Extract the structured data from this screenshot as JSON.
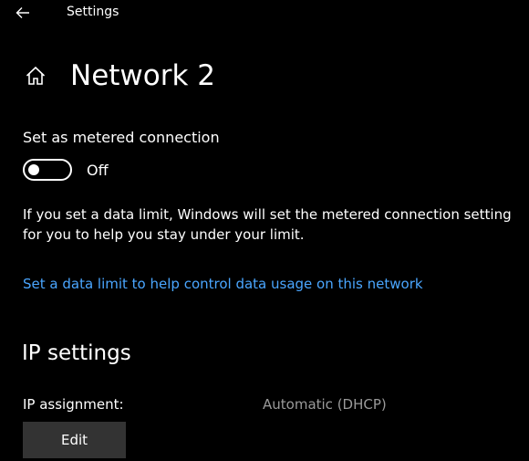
{
  "window": {
    "title": "Settings",
    "back_icon": "back-arrow-icon"
  },
  "page": {
    "title": "Network 2",
    "home_icon": "home-icon"
  },
  "metered": {
    "label": "Set as metered connection",
    "toggle_state": "Off",
    "toggle_on": false,
    "description": "If you set a data limit, Windows will set the metered connection setting for you to help you stay under your limit.",
    "link_text": "Set a data limit to help control data usage on this network"
  },
  "ip_settings": {
    "title": "IP settings",
    "assignment_label": "IP assignment:",
    "assignment_value": "Automatic (DHCP)",
    "edit_label": "Edit"
  },
  "colors": {
    "background": "#000000",
    "text": "#ffffff",
    "link": "#4aa6ff",
    "secondary_text": "#9a9a9a",
    "button": "#333333"
  }
}
